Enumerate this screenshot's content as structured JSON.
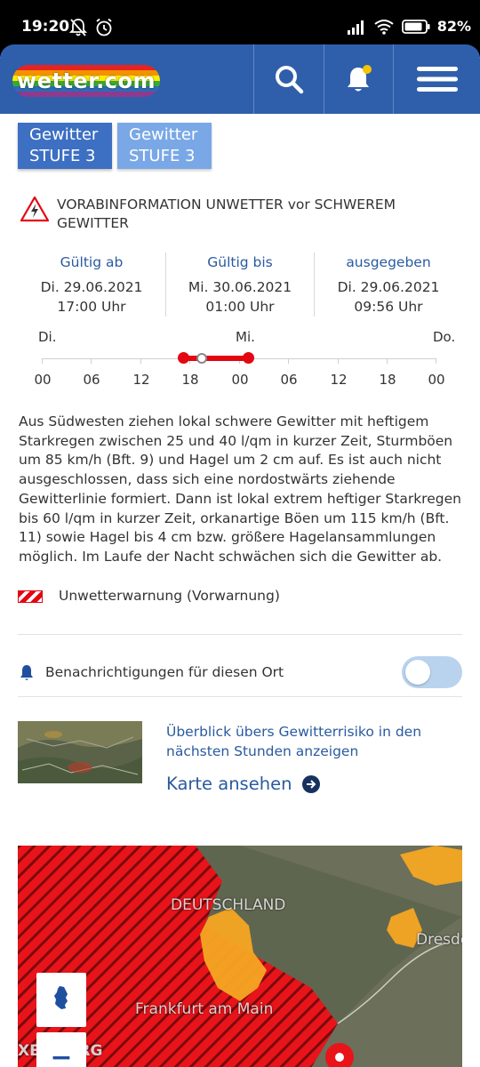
{
  "status_bar": {
    "time": "19:20",
    "battery": "82%"
  },
  "header": {
    "logo_text": "wetter.com"
  },
  "badges": [
    {
      "line1": "Gewitter",
      "line2": "STUFE 3"
    },
    {
      "line1": "Gewitter",
      "line2": "STUFE 3"
    }
  ],
  "warning": {
    "title": "VORABINFORMATION UNWETTER vor SCHWEREM GEWITTER"
  },
  "validity": [
    {
      "label": "Gültig ab",
      "date": "Di. 29.06.2021",
      "time": "17:00 Uhr"
    },
    {
      "label": "Gültig bis",
      "date": "Mi. 30.06.2021",
      "time": "01:00 Uhr"
    },
    {
      "label": "ausgegeben",
      "date": "Di. 29.06.2021",
      "time": "09:56 Uhr"
    }
  ],
  "timeline": {
    "days": [
      "Di.",
      "Mi.",
      "Do."
    ],
    "hours": [
      "00",
      "06",
      "12",
      "18",
      "00",
      "06",
      "12",
      "18",
      "00"
    ]
  },
  "description": "Aus Südwesten ziehen lokal schwere Gewitter mit heftigem Starkregen zwischen 25 und 40 l/qm in kurzer Zeit, Sturmböen um 85 km/h (Bft. 9) und Hagel um 2 cm auf. Es ist auch nicht ausgeschlossen, dass sich eine nordostwärts ziehende Gewitterlinie formiert. Dann ist lokal extrem heftiger Starkregen bis 60 l/qm in kurzer Zeit, orkanartige Böen um 115 km/h (Bft. 11) sowie Hagel bis 4 cm bzw. größere Hagelansammlungen möglich. Im Laufe der Nacht schwächen sich die Gewitter ab.",
  "legend": {
    "text": "Unwetterwarnung (Vorwarnung)"
  },
  "notifications": {
    "label": "Benachrichtigungen für diesen Ort",
    "enabled": false
  },
  "teaser": {
    "text": "Überblick übers Gewitterrisiko in den nächsten Stunden anzeigen",
    "link": "Karte ansehen"
  },
  "map": {
    "zoom_in": "+",
    "zoom_out": "−",
    "labels": {
      "country": "DEUTSCHLAND",
      "city1": "Frankfurt am Main",
      "city2": "Dresde",
      "country2": "XEMBURG"
    }
  },
  "colors": {
    "brand_blue": "#2f5fab",
    "link_blue": "#2a5a9f",
    "warning_red": "#e30613",
    "storm_orange": "#f5a623"
  }
}
